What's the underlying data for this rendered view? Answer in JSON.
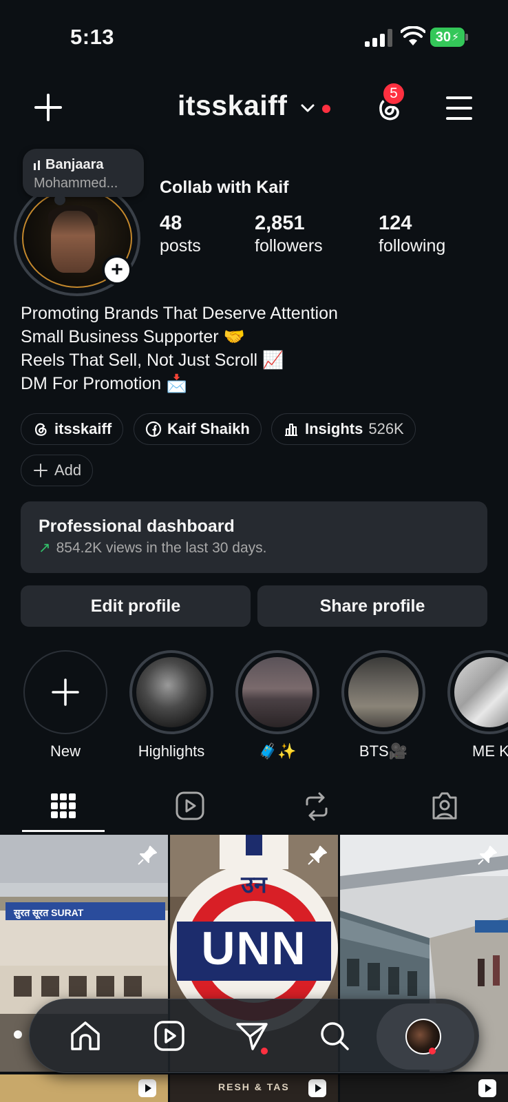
{
  "status_bar": {
    "time": "5:13",
    "battery": "30"
  },
  "header": {
    "username": "itsskaiff",
    "notification_count": "5"
  },
  "note": {
    "song": "Banjaara",
    "artist": "Mohammed..."
  },
  "profile": {
    "display_name": "Collab with Kaif",
    "stats": {
      "posts": {
        "value": "48",
        "label": "posts"
      },
      "followers": {
        "value": "2,851",
        "label": "followers"
      },
      "following": {
        "value": "124",
        "label": "following"
      }
    },
    "bio": [
      "Promoting Brands That Deserve Attention",
      "Small Business Supporter 🤝",
      "Reels That Sell, Not Just Scroll 📈",
      "DM For Promotion 📩"
    ]
  },
  "links": {
    "threads": "itsskaiff",
    "facebook": "Kaif Shaikh",
    "insights_label": "Insights",
    "insights_value": "526K",
    "add": "Add"
  },
  "dashboard": {
    "title": "Professional dashboard",
    "subtitle": "854.2K views in the last 30 days."
  },
  "buttons": {
    "edit": "Edit profile",
    "share": "Share profile"
  },
  "highlights": [
    {
      "label": "New"
    },
    {
      "label": "Highlights"
    },
    {
      "label": "🧳✨"
    },
    {
      "label": "BTS🎥"
    },
    {
      "label": "ME K"
    }
  ],
  "grid": {
    "post1_sign": "सुरत  सूरत  SURAT",
    "post2_top": "उन",
    "post2_main": "UNN",
    "post_row2_text": "RESH & TAS"
  },
  "colors": {
    "accent_red": "#ff3040",
    "background": "#0c1014",
    "card": "#262a30",
    "trend_green": "#33c16a"
  }
}
